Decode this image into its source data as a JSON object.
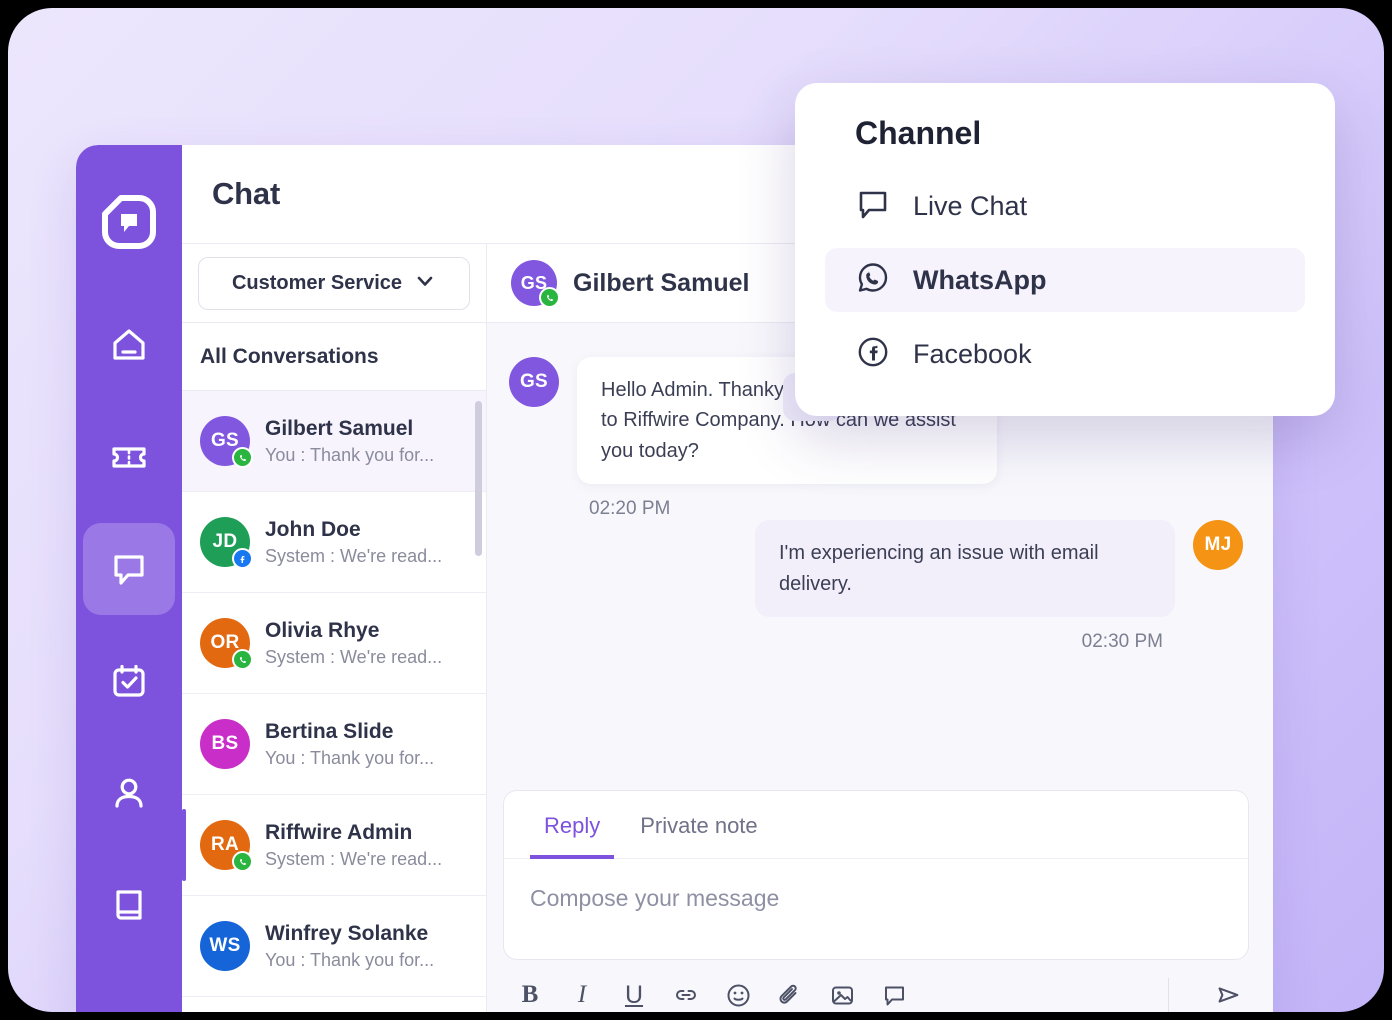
{
  "window": {
    "title": "Chat"
  },
  "rail": {
    "logo_name": "riffwire-logo",
    "items": [
      {
        "name": "home",
        "icon": "home-icon",
        "active": false
      },
      {
        "name": "tickets",
        "icon": "ticket-icon",
        "active": false
      },
      {
        "name": "chat",
        "icon": "chat-bubble-icon",
        "active": true
      },
      {
        "name": "tasks",
        "icon": "calendar-check-icon",
        "active": false
      },
      {
        "name": "contacts",
        "icon": "person-icon",
        "active": false
      },
      {
        "name": "knowledge-base",
        "icon": "book-icon",
        "active": false
      }
    ]
  },
  "conversations_panel": {
    "filter_label": "Customer Service",
    "filter_icon": "chevron-down-icon",
    "list_header": "All Conversations",
    "items": [
      {
        "initials": "GS",
        "name": "Gilbert Samuel",
        "preview": "You : Thank you for...",
        "color": "#8257e0",
        "channel": "whatsapp",
        "selected": true,
        "marked": false
      },
      {
        "initials": "JD",
        "name": "John Doe",
        "preview": "System : We're read...",
        "color": "#1f9e57",
        "channel": "facebook",
        "selected": false,
        "marked": false
      },
      {
        "initials": "OR",
        "name": "Olivia Rhye",
        "preview": "System : We're read...",
        "color": "#e2690f",
        "channel": "whatsapp",
        "selected": false,
        "marked": false
      },
      {
        "initials": "BS",
        "name": "Bertina Slide",
        "preview": "You : Thank you for...",
        "color": "#c92ec9",
        "channel": "none",
        "selected": false,
        "marked": false
      },
      {
        "initials": "RA",
        "name": "Riffwire Admin",
        "preview": "System : We're read...",
        "color": "#e2690f",
        "channel": "whatsapp",
        "selected": false,
        "marked": true
      },
      {
        "initials": "WS",
        "name": "Winfrey Solanke",
        "preview": "You : Thank you for...",
        "color": "#1565d8",
        "channel": "none",
        "selected": false,
        "marked": false
      }
    ]
  },
  "chat": {
    "contact_initials": "GS",
    "contact_name": "Gilbert Samuel",
    "contact_color": "#8257e0",
    "contact_channel": "whatsapp",
    "messages": [
      {
        "direction": "in",
        "initials": "GS",
        "color": "#8257e0",
        "text": "Hello Admin. Thankyou for reaching out to Riffwire Company. How can we assist you today?",
        "time": "02:20 PM"
      },
      {
        "direction": "out",
        "initials": "MJ",
        "color": "#f59314",
        "text": "I'm experiencing an issue with email delivery.",
        "time": "02:30 PM"
      }
    ]
  },
  "composer": {
    "tabs": [
      {
        "label": "Reply",
        "active": true
      },
      {
        "label": "Private note",
        "active": false
      }
    ],
    "placeholder": "Compose your message",
    "tools": [
      {
        "name": "bold-icon",
        "glyph": "B"
      },
      {
        "name": "italic-icon",
        "glyph": "I"
      },
      {
        "name": "underline-icon",
        "glyph": "U"
      },
      {
        "name": "link-icon",
        "glyph": ""
      },
      {
        "name": "emoji-icon",
        "glyph": ""
      },
      {
        "name": "attachment-icon",
        "glyph": ""
      },
      {
        "name": "image-icon",
        "glyph": ""
      },
      {
        "name": "canned-response-icon",
        "glyph": ""
      }
    ],
    "send_icon": "send-icon"
  },
  "popover": {
    "title": "Channel",
    "items": [
      {
        "label": "Live Chat",
        "icon": "live-chat-icon",
        "active": false
      },
      {
        "label": "WhatsApp",
        "icon": "whatsapp-icon",
        "active": true
      },
      {
        "label": "Facebook",
        "icon": "facebook-icon",
        "active": false
      }
    ]
  },
  "theme": {
    "brand_purple": "#7d52dd",
    "rail_active": "#9a78e6",
    "whatsapp_green": "#2ab540",
    "facebook_blue": "#1878f2",
    "text_dark": "#2f3349",
    "text_muted": "#8a8b9c"
  }
}
